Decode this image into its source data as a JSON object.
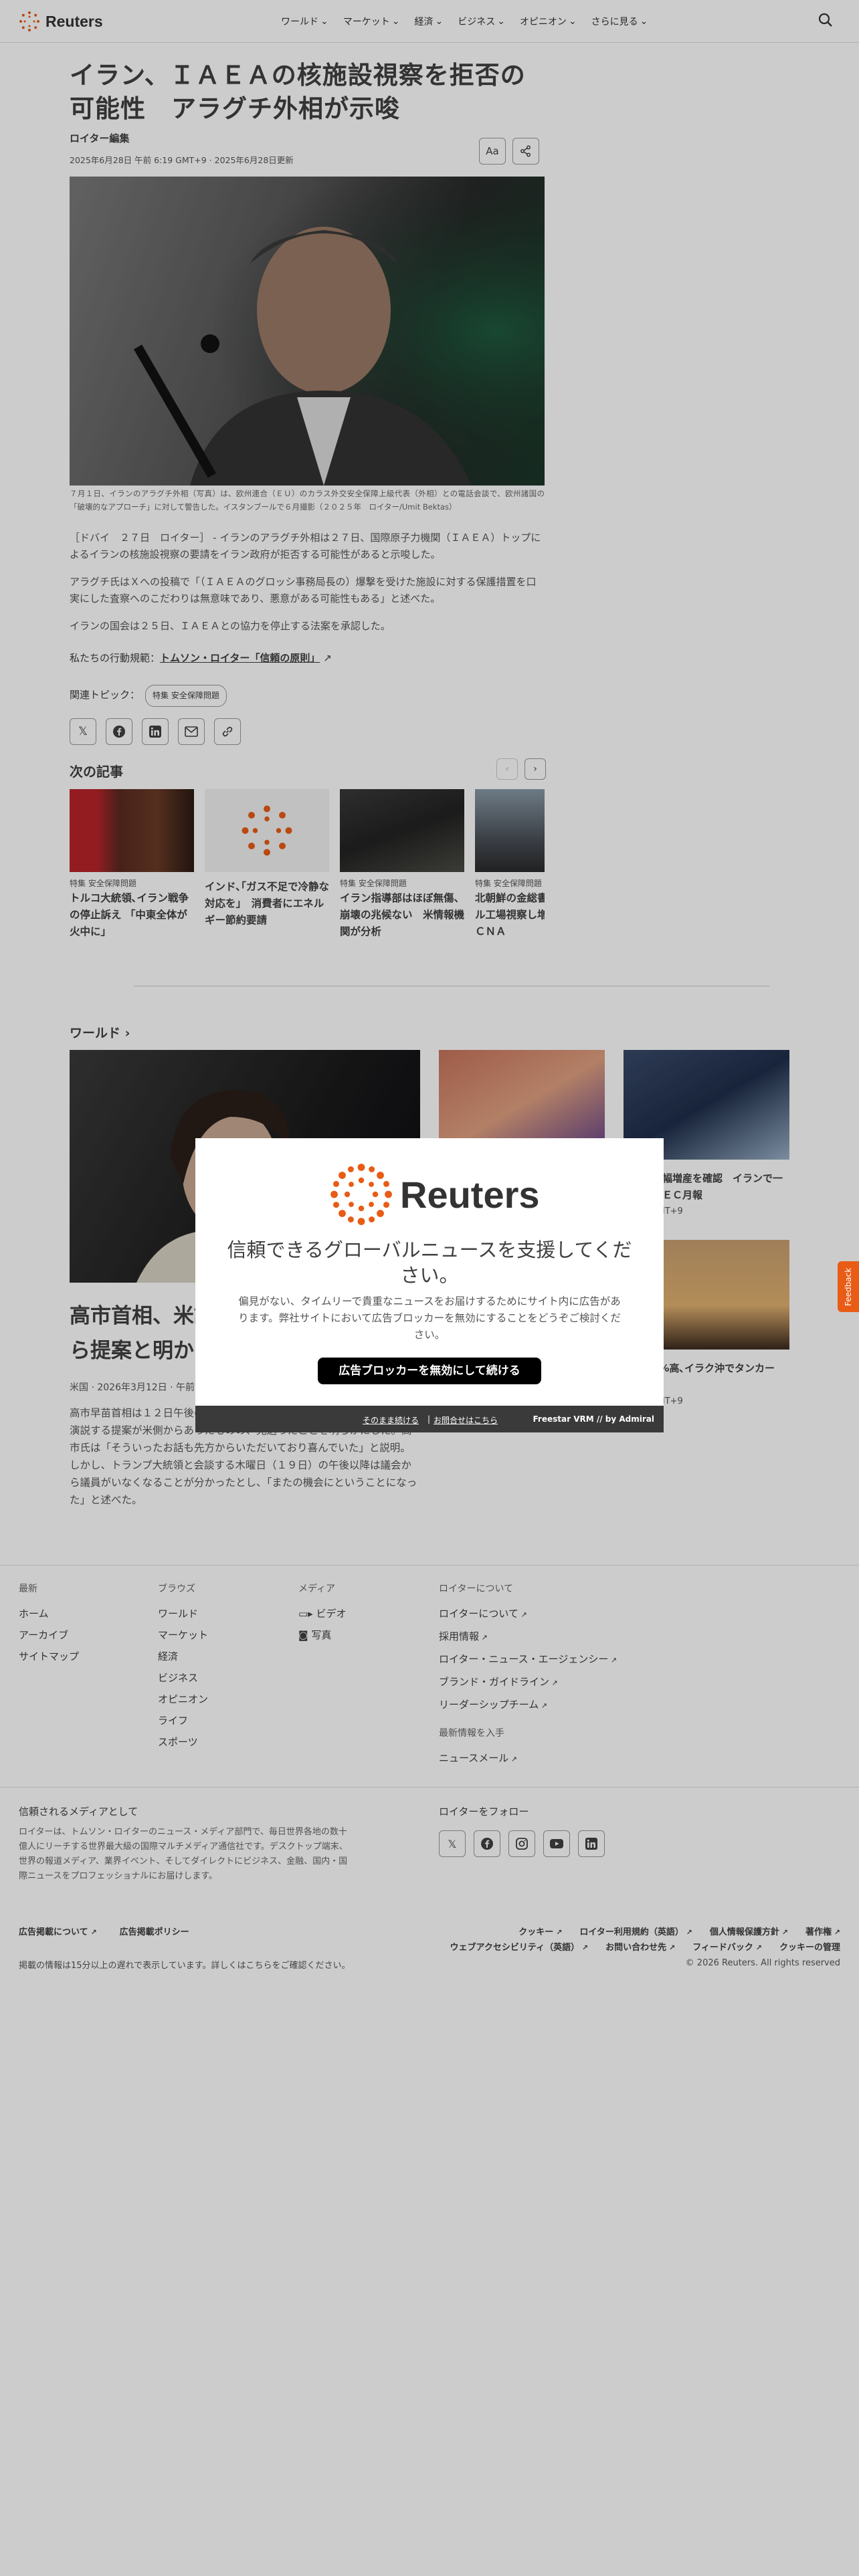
{
  "brand": {
    "name": "Reuters",
    "accent": "#e85c16"
  },
  "nav": {
    "items": [
      {
        "label": "ワールド"
      },
      {
        "label": "マーケット"
      },
      {
        "label": "経済"
      },
      {
        "label": "ビジネス"
      },
      {
        "label": "オピニオン"
      },
      {
        "label": "さらに見る"
      }
    ],
    "search_icon": "search-icon"
  },
  "article": {
    "title": "イラン、ＩＡＥＡの核施設視察を拒否の可能性　アラグチ外相が示唆",
    "byline": "ロイター編集",
    "date": "2025年6月28日 午前 6:19 GMT+9 · 2025年6月28日更新",
    "font_button": "Aa",
    "caption": "７月１日、イランのアラグチ外相（写真）は、欧州連合（ＥＵ）のカラス外交安全保障上級代表（外相）との電話会談で、欧州諸国の「破壊的なアプローチ」に対して警告した。イスタンブールで６月撮影（２０２５年　ロイター/Umit Bektas）",
    "paragraphs": [
      "［ドバイ　２７日　ロイター］ - イランのアラグチ外相は２７日、国際原子力機関（ＩＡＥＡ）トップによるイランの核施設視察の要請をイラン政府が拒否する可能性があると示唆した。",
      "アラグチ氏はＸへの投稿で「（ＩＡＥＡのグロッシ事務局長の）爆撃を受けた施設に対する保護措置を口実にした査察へのこだわりは無意味であり、悪意がある可能性もある」と述べた。",
      "イランの国会は２５日、ＩＡＥＡとの協力を停止する法案を承認した。"
    ],
    "trust_prefix": "私たちの行動規範：",
    "trust_link": "トムソン・ロイター「信頼の原則」",
    "related_label": "関連トピック：",
    "related_tag": "特集 安全保障問題"
  },
  "next": {
    "title": "次の記事",
    "cards": [
      {
        "kicker": "特集 安全保障問題",
        "headline": "トルコ大統領､イラン戦争の停止訴え 「中東全体が火中に」"
      },
      {
        "kicker": "",
        "headline": "インド､｢ガス不足で冷静な対応を｣　消費者にエネルギー節約要請"
      },
      {
        "kicker": "特集 安全保障問題",
        "headline": "イラン指導部はほぼ無傷、崩壊の兆候ない　米情報機関が分析"
      },
      {
        "kicker": "特集 安全保障問題",
        "headline": "北朝鮮の金総書記、ミサイル工場視察し増産指示＝ＫＣＮＡ"
      }
    ]
  },
  "world": {
    "title": "ワールド",
    "main": {
      "headline": "高市首相、米議会での演説は米側から提案と明かす",
      "date": "米国 · 2026年3月12日 · 午前",
      "text": "高市早苗首相は１２日午後の参院予算委員会で、来週の訪米時に米議会で演説する提案が米側からあったものの、見送ったことを明らかにした。高市氏は「そういったお話も先方からいただいており喜んでいた」と説明。しかし、トランプ大統領と会談する木曜日（１９日）の午後以降は議会から議員がいなくなることが分かったとし、「またの機会にということになった」と述べた。"
    },
    "side": [
      {
        "headline": "",
        "date": ""
      },
      {
        "headline": "９大幅増産を確認　イランで一ＯＰＥＣ月報",
        "date": "6 GMT+9"
      },
      {
        "headline": "",
        "date": ""
      },
      {
        "headline": "約6%高､イラク沖でタンカー",
        "date": "0 GMT+9"
      }
    ]
  },
  "footer": {
    "cols": [
      {
        "heading": "最新",
        "links": [
          "ホーム",
          "アーカイブ",
          "サイトマップ"
        ]
      },
      {
        "heading": "ブラウズ",
        "links": [
          "ワールド",
          "マーケット",
          "経済",
          "ビジネス",
          "オピニオン",
          "ライフ",
          "スポーツ"
        ]
      },
      {
        "heading": "メディア",
        "links": [
          "ビデオ",
          "写真"
        ]
      },
      {
        "heading": "ロイターについて",
        "links": [
          "ロイターについて",
          "採用情報",
          "ロイター・ニュース・エージェンシー",
          "ブランド・ガイドライン",
          "リーダーシップチーム"
        ]
      }
    ],
    "news_heading": "最新情報を入手",
    "news_link": "ニュースメール",
    "trust_heading": "信頼されるメディアとして",
    "trust_text": "ロイターは、トムソン・ロイターのニュース・メディア部門で、毎日世界各地の数十億人にリーチする世界最大級の国際マルチメディア通信社です。デスクトップ端末、世界の報道メディア、業界イベント、そしてダイレクトにビジネス、金融、国内・国際ニュースをプロフェッショナルにお届けします。",
    "follow_heading": "ロイターをフォロー",
    "legal_left": [
      "広告掲載について",
      "広告掲載ポリシー"
    ],
    "legal_right": [
      "クッキー",
      "ロイター利用規約（英語）",
      "個人情報保護方針",
      "著作権",
      "ウェブアクセシビリティ（英語）",
      "お問い合わせ先",
      "フィードバック",
      "クッキーの管理"
    ],
    "note": "掲載の情報は15分以上の遅れで表示しています。詳しくはこちらをご確認ください。",
    "copyright": "© 2026 Reuters. All rights reserved"
  },
  "modal": {
    "logo": "Reuters",
    "title": "信頼できるグローバルニュースを支援してください。",
    "body": "偏見がない、タイムリーで貴重なニュースをお届けするためにサイト内に広告があります。弊社サイトにおいて広告ブロッカーを無効にすることをどうぞご検討ください。",
    "button": "広告ブロッカーを無効にして続ける",
    "link1": "そのまま続ける",
    "link2": "お問合せはこちら",
    "power": "Freestar VRM  // by Admiral"
  },
  "feedback": "Feedback"
}
